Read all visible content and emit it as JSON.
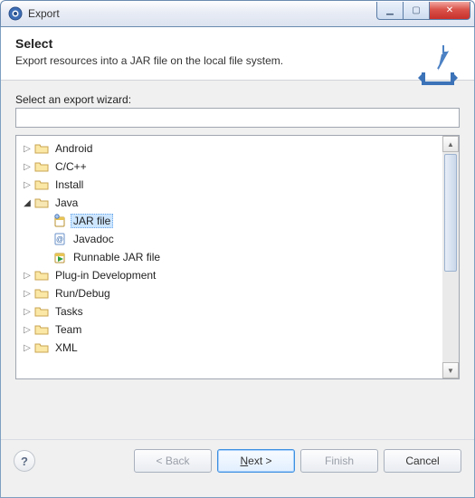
{
  "window": {
    "title": "Export"
  },
  "banner": {
    "heading": "Select",
    "subtitle": "Export resources into a JAR file on the local file system."
  },
  "wizard": {
    "filter_label": "Select an export wizard:",
    "filter_value": ""
  },
  "tree": {
    "items": [
      {
        "label": "Android",
        "expanded": false,
        "depth": 0,
        "icon": "folder",
        "selected": false,
        "has_children": true
      },
      {
        "label": "C/C++",
        "expanded": false,
        "depth": 0,
        "icon": "folder",
        "selected": false,
        "has_children": true
      },
      {
        "label": "Install",
        "expanded": false,
        "depth": 0,
        "icon": "folder",
        "selected": false,
        "has_children": true
      },
      {
        "label": "Java",
        "expanded": true,
        "depth": 0,
        "icon": "folder-open",
        "selected": false,
        "has_children": true
      },
      {
        "label": "JAR file",
        "expanded": false,
        "depth": 1,
        "icon": "jar-icon",
        "selected": true,
        "has_children": false
      },
      {
        "label": "Javadoc",
        "expanded": false,
        "depth": 1,
        "icon": "javadoc-icon",
        "selected": false,
        "has_children": false
      },
      {
        "label": "Runnable JAR file",
        "expanded": false,
        "depth": 1,
        "icon": "runnable-jar-icon",
        "selected": false,
        "has_children": false
      },
      {
        "label": "Plug-in Development",
        "expanded": false,
        "depth": 0,
        "icon": "folder",
        "selected": false,
        "has_children": true
      },
      {
        "label": "Run/Debug",
        "expanded": false,
        "depth": 0,
        "icon": "folder",
        "selected": false,
        "has_children": true
      },
      {
        "label": "Tasks",
        "expanded": false,
        "depth": 0,
        "icon": "folder",
        "selected": false,
        "has_children": true
      },
      {
        "label": "Team",
        "expanded": false,
        "depth": 0,
        "icon": "folder",
        "selected": false,
        "has_children": true
      },
      {
        "label": "XML",
        "expanded": false,
        "depth": 0,
        "icon": "folder",
        "selected": false,
        "has_children": true
      }
    ]
  },
  "buttons": {
    "back": "< Back",
    "next": "Next >",
    "finish": "Finish",
    "cancel": "Cancel"
  }
}
